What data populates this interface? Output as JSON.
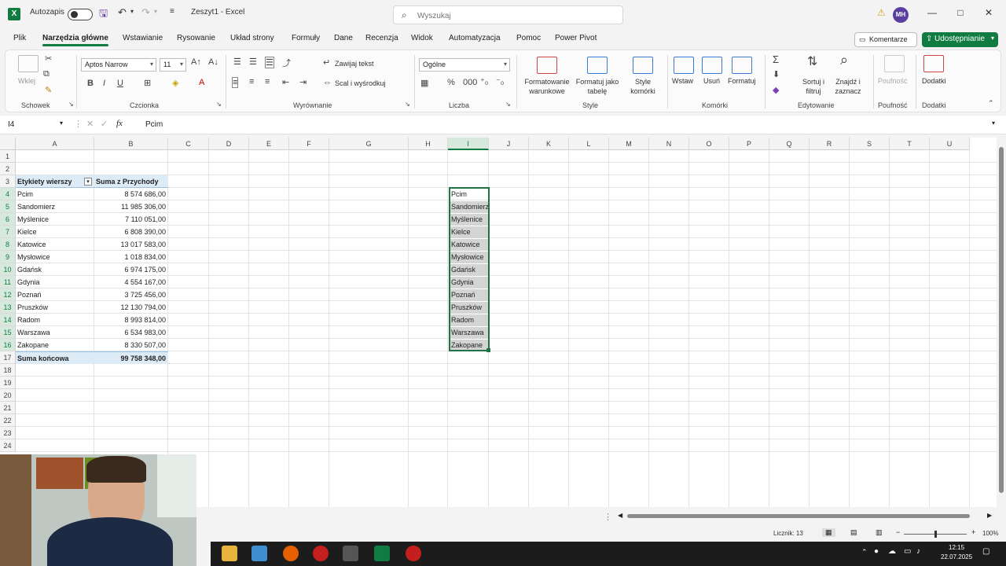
{
  "window": {
    "app_letter": "X",
    "autosave_label": "Autozapis",
    "title": "Zeszyt1 - Excel",
    "search_placeholder": "Wyszukaj",
    "avatar_initials": "MH",
    "minimize": "—",
    "maximize": "□",
    "close": "✕"
  },
  "menu": {
    "tabs": [
      "Plik",
      "Narzędzia główne",
      "Wstawianie",
      "Rysowanie",
      "Układ strony",
      "Formuły",
      "Dane",
      "Recenzja",
      "Widok",
      "Automatyzacja",
      "Pomoc",
      "Power Pivot"
    ],
    "active_tab": "Narzędzia główne",
    "comments_label": "Komentarze",
    "share_label": "Udostępnianie"
  },
  "ribbon": {
    "clipboard": {
      "paste": "Wklej",
      "group": "Schowek"
    },
    "font": {
      "name": "Aptos Narrow",
      "size": "11",
      "bold": "B",
      "italic": "I",
      "underline": "U",
      "group": "Czcionka"
    },
    "alignment": {
      "wrap": "Zawijaj tekst",
      "merge": "Scal i wyśrodkuj",
      "group": "Wyrównanie"
    },
    "number": {
      "format": "Ogólne",
      "group": "Liczba"
    },
    "styles": {
      "conditional": "Formatowanie warunkowe",
      "as_table": "Formatuj jako tabelę",
      "cell_styles": "Style komórki",
      "group": "Style"
    },
    "cells": {
      "insert": "Wstaw",
      "delete": "Usuń",
      "format": "Formatuj",
      "group": "Komórki"
    },
    "editing": {
      "sort": "Sortuj i filtruj",
      "find": "Znajdź i zaznacz",
      "group": "Edytowanie"
    },
    "sensitivity": {
      "label": "Poufność",
      "group": "Poufność"
    },
    "addins": {
      "label": "Dodatki",
      "group": "Dodatki"
    }
  },
  "formula_bar": {
    "name_box": "I4",
    "fx": "fx",
    "content": "Pcim"
  },
  "sheet": {
    "columns": [
      "A",
      "B",
      "C",
      "D",
      "E",
      "F",
      "G",
      "H",
      "I",
      "J",
      "K",
      "L",
      "M",
      "N",
      "O",
      "P",
      "Q",
      "R",
      "S",
      "T",
      "U"
    ],
    "rows": [
      "1",
      "2",
      "3",
      "4",
      "5",
      "6",
      "7",
      "8",
      "9",
      "10",
      "11",
      "12",
      "13",
      "14",
      "15",
      "16",
      "17",
      "18",
      "19",
      "20",
      "21",
      "22",
      "23",
      "24"
    ],
    "pivot": {
      "header_row_label": "Etykiety wierszy",
      "header_sum": "Suma z Przychody",
      "rows": [
        {
          "city": "Pcim",
          "value": "8 574 686,00"
        },
        {
          "city": "Sandomierz",
          "value": "11 985 306,00"
        },
        {
          "city": "Myślenice",
          "value": "7 110 051,00"
        },
        {
          "city": "Kielce",
          "value": "6 808 390,00"
        },
        {
          "city": "Katowice",
          "value": "13 017 583,00"
        },
        {
          "city": "Mysłowice",
          "value": "1 018 834,00"
        },
        {
          "city": "Gdańsk",
          "value": "6 974 175,00"
        },
        {
          "city": "Gdynia",
          "value": "4 554 167,00"
        },
        {
          "city": "Poznań",
          "value": "3 725 456,00"
        },
        {
          "city": "Pruszków",
          "value": "12 130 794,00"
        },
        {
          "city": "Radom",
          "value": "8 993 814,00"
        },
        {
          "city": "Warszawa",
          "value": "6 534 983,00"
        },
        {
          "city": "Zakopane",
          "value": "8 330 507,00"
        }
      ],
      "total_label": "Suma końcowa",
      "total_value": "99 758 348,00"
    },
    "column_i": [
      "Pcim",
      "Sandomierz",
      "Myślenice",
      "Kielce",
      "Katowice",
      "Mysłowice",
      "Gdańsk",
      "Gdynia",
      "Poznań",
      "Pruszków",
      "Radom",
      "Warszawa",
      "Zakopane"
    ]
  },
  "status": {
    "count": "Licznik: 13",
    "zoom": "100%"
  },
  "taskbar": {
    "time": "12:15",
    "date": "22.07.2025"
  }
}
